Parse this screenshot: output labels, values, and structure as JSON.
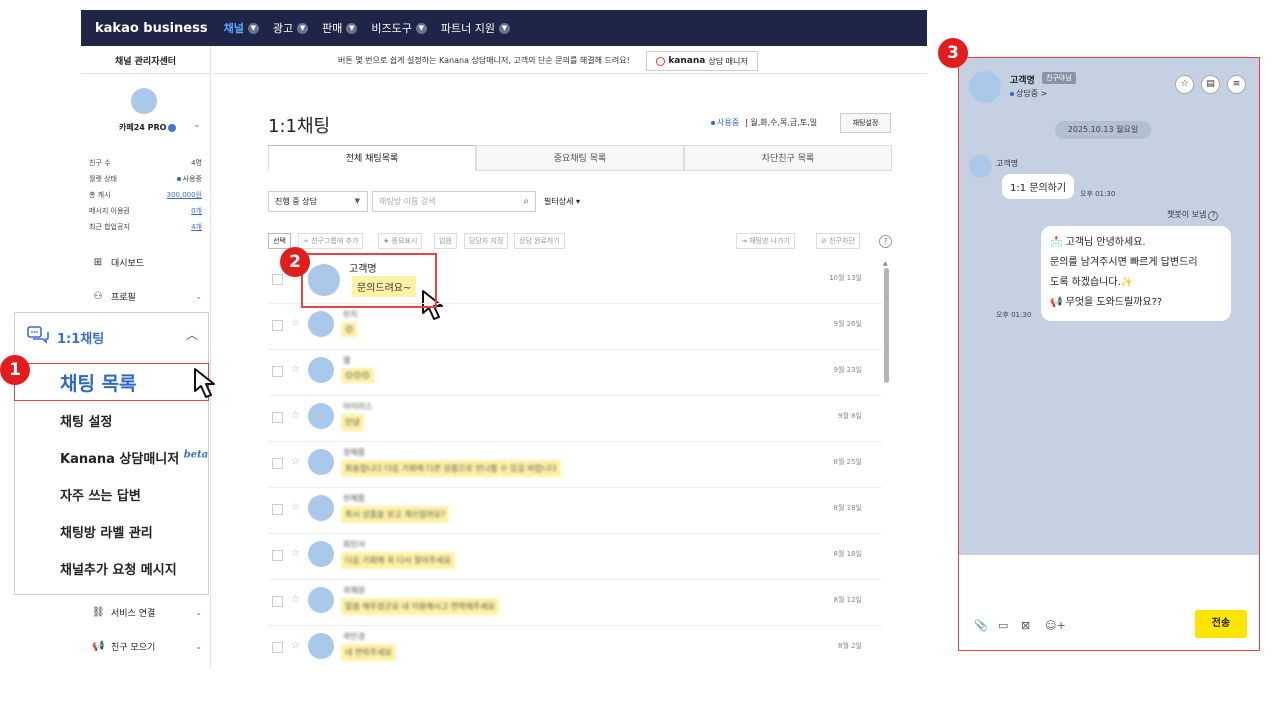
{
  "nav": {
    "brand": "kakao business",
    "items": [
      "채널",
      "광고",
      "판매",
      "비즈도구",
      "파트너 지원"
    ]
  },
  "sidebar": {
    "title": "채널 관리자센터",
    "channel_name": "카페24 PRO",
    "stats": [
      {
        "label": "친구 수",
        "value": "4명"
      },
      {
        "label": "월렛 상태",
        "value": "사용중"
      },
      {
        "label": "총 캐시",
        "value": "300,000원"
      },
      {
        "label": "메시지 이용권",
        "value": "0개"
      },
      {
        "label": "최근 합업공지",
        "value": "4개"
      }
    ],
    "menu_top": [
      {
        "icon": "grid-icon",
        "label": "대시보드"
      },
      {
        "icon": "person-icon",
        "label": "프로필"
      }
    ],
    "menu_bottom": [
      {
        "icon": "link-icon",
        "label": "서비스 연결"
      },
      {
        "icon": "megaphone-icon",
        "label": "친구 모으기"
      }
    ]
  },
  "zoom_panel": {
    "header": "1:1채팅",
    "active_item": "채팅 목록",
    "items": [
      "채팅 설정",
      "Kanana 상담매니저",
      "자주 쓰는 답변",
      "채팅방 라벨 관리",
      "채널추가 요청 메시지"
    ],
    "beta": "beta"
  },
  "badges": [
    "1",
    "2",
    "3"
  ],
  "promo": {
    "text": "버튼 몇 번으로 쉽게 설정하는 Kanana 상담매니저, 고객의 단순 문의를 해결해 드려요!",
    "brand": "kanana",
    "btn_label": "상담 매니저"
  },
  "main": {
    "title": "1:1채팅",
    "status_on": "사용중",
    "status_days": "월,화,수,목,금,토,일",
    "settings_btn": "채팅설정",
    "tabs": [
      "전체 채팅목록",
      "중요채팅 목록",
      "차단친구 목록"
    ],
    "filter_value": "진행 중 상담",
    "search_placeholder": "채팅방 이름 검색",
    "filter_detail": "필터상세",
    "toolbar_left": [
      "선택",
      "+ 친구그룹에 추가",
      "★ 중요표시",
      "읽음",
      "담당자 지정",
      "상담 완료하기"
    ],
    "toolbar_right": [
      "채팅방 나가기",
      "친구차단"
    ],
    "rows": [
      {
        "name": "고객명",
        "msg": "문의드려요~",
        "date": "10월 13일"
      },
      {
        "name": "린지",
        "msg": "😊",
        "date": "9월 26일"
      },
      {
        "name": "헬",
        "msg": "😊😊😊",
        "date": "9월 23일"
      },
      {
        "name": "아이러스",
        "msg": "안녕",
        "date": "9월 8일"
      },
      {
        "name": "정혜름",
        "msg": "최송합니다 다음 기회에 다른 상품으로 만나뵐 수 있길 바랍니다",
        "date": "8월 25일"
      },
      {
        "name": "천혜름",
        "msg": "혹시 상품을 보고 계신걸까요?",
        "date": "8월 18일"
      },
      {
        "name": "최민서",
        "msg": "다음 기회에 꼭 다시 찾아주세요",
        "date": "8월 18일"
      },
      {
        "name": "곽채원",
        "msg": "말씀 해주셨군요 네 이용해시고 연락해주세요",
        "date": "8월 12일"
      },
      {
        "name": "곽민경",
        "msg": "네 연락주세요",
        "date": "8월 2일"
      }
    ]
  },
  "chat": {
    "name": "고객명",
    "tag": "친구아님",
    "status": "상담중 >",
    "date": "2025.10.13 월요일",
    "sender": "고객명",
    "incoming": "1:1 문의하기",
    "time_in": "오후 01:30",
    "bot_label": "챗봇이 보냄",
    "bot_help": "?",
    "outgoing": [
      "📩 고객님 안녕하세요.",
      "문의를 남겨주시면 빠르게 답변드리",
      "도록 하겠습니다.✨",
      "📢 무엇을 도와드릴까요??"
    ],
    "time_out": "오후 01:30",
    "send": "전송"
  }
}
